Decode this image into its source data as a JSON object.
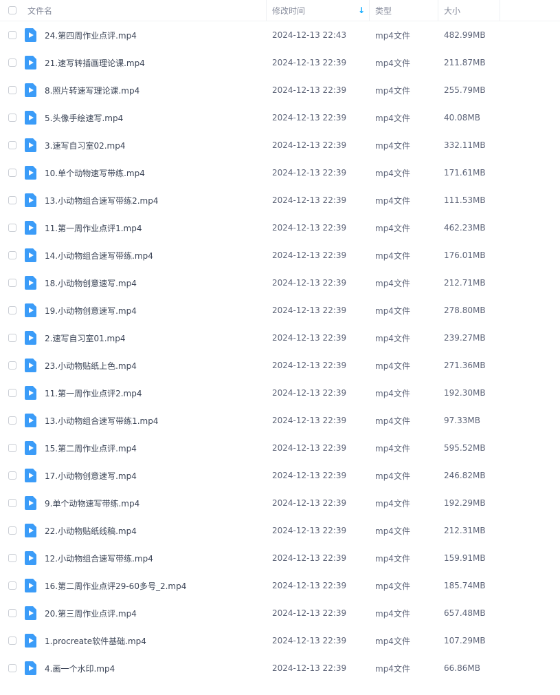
{
  "header": {
    "name_label": "文件名",
    "date_label": "修改时间",
    "type_label": "类型",
    "size_label": "大小",
    "sort_icon": "arrow-down-icon"
  },
  "colors": {
    "accent": "#06a7ff",
    "file_icon": "#3b9cf8",
    "text": "#3b4456",
    "muted": "#878c9c"
  },
  "files": [
    {
      "name": "24.第四周作业点评.mp4",
      "date": "2024-12-13 22:43",
      "type": "mp4文件",
      "size": "482.99MB"
    },
    {
      "name": "21.速写转插画理论课.mp4",
      "date": "2024-12-13 22:39",
      "type": "mp4文件",
      "size": "211.87MB"
    },
    {
      "name": "8.照片转速写理论课.mp4",
      "date": "2024-12-13 22:39",
      "type": "mp4文件",
      "size": "255.79MB"
    },
    {
      "name": "5.头像手绘速写.mp4",
      "date": "2024-12-13 22:39",
      "type": "mp4文件",
      "size": "40.08MB"
    },
    {
      "name": "3.速写自习室02.mp4",
      "date": "2024-12-13 22:39",
      "type": "mp4文件",
      "size": "332.11MB"
    },
    {
      "name": "10.单个动物速写带练.mp4",
      "date": "2024-12-13 22:39",
      "type": "mp4文件",
      "size": "171.61MB"
    },
    {
      "name": "13.小动物组合速写带练2.mp4",
      "date": "2024-12-13 22:39",
      "type": "mp4文件",
      "size": "111.53MB"
    },
    {
      "name": "11.第一周作业点评1.mp4",
      "date": "2024-12-13 22:39",
      "type": "mp4文件",
      "size": "462.23MB"
    },
    {
      "name": "14.小动物组合速写带练.mp4",
      "date": "2024-12-13 22:39",
      "type": "mp4文件",
      "size": "176.01MB"
    },
    {
      "name": "18.小动物创意速写.mp4",
      "date": "2024-12-13 22:39",
      "type": "mp4文件",
      "size": "212.71MB"
    },
    {
      "name": "19.小动物创意速写.mp4",
      "date": "2024-12-13 22:39",
      "type": "mp4文件",
      "size": "278.80MB"
    },
    {
      "name": "2.速写自习室01.mp4",
      "date": "2024-12-13 22:39",
      "type": "mp4文件",
      "size": "239.27MB"
    },
    {
      "name": "23.小动物贴纸上色.mp4",
      "date": "2024-12-13 22:39",
      "type": "mp4文件",
      "size": "271.36MB"
    },
    {
      "name": "11.第一周作业点评2.mp4",
      "date": "2024-12-13 22:39",
      "type": "mp4文件",
      "size": "192.30MB"
    },
    {
      "name": "13.小动物组合速写带练1.mp4",
      "date": "2024-12-13 22:39",
      "type": "mp4文件",
      "size": "97.33MB"
    },
    {
      "name": "15.第二周作业点评.mp4",
      "date": "2024-12-13 22:39",
      "type": "mp4文件",
      "size": "595.52MB"
    },
    {
      "name": "17.小动物创意速写.mp4",
      "date": "2024-12-13 22:39",
      "type": "mp4文件",
      "size": "246.82MB"
    },
    {
      "name": "9.单个动物速写带练.mp4",
      "date": "2024-12-13 22:39",
      "type": "mp4文件",
      "size": "192.29MB"
    },
    {
      "name": "22.小动物贴纸线稿.mp4",
      "date": "2024-12-13 22:39",
      "type": "mp4文件",
      "size": "212.31MB"
    },
    {
      "name": "12.小动物组合速写带练.mp4",
      "date": "2024-12-13 22:39",
      "type": "mp4文件",
      "size": "159.91MB"
    },
    {
      "name": "16.第二周作业点评29-60多号_2.mp4",
      "date": "2024-12-13 22:39",
      "type": "mp4文件",
      "size": "185.74MB"
    },
    {
      "name": "20.第三周作业点评.mp4",
      "date": "2024-12-13 22:39",
      "type": "mp4文件",
      "size": "657.48MB"
    },
    {
      "name": "1.procreate软件基础.mp4",
      "date": "2024-12-13 22:39",
      "type": "mp4文件",
      "size": "107.29MB"
    },
    {
      "name": "4.画一个水印.mp4",
      "date": "2024-12-13 22:39",
      "type": "mp4文件",
      "size": "66.86MB"
    }
  ]
}
